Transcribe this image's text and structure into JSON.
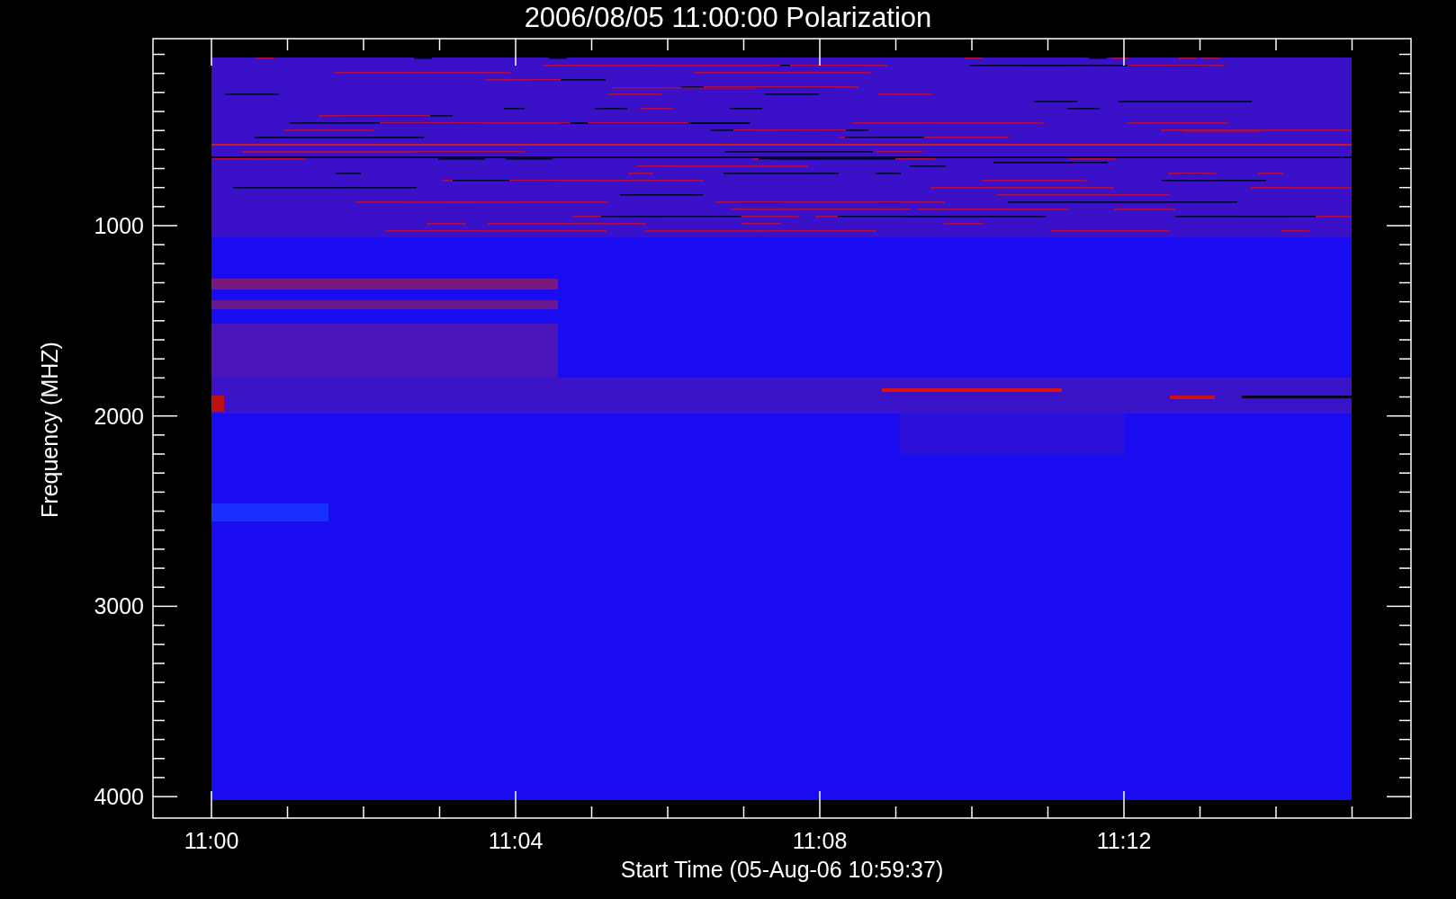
{
  "title": "2006/08/05 11:00:00 Polarization",
  "y_axis": {
    "label": "Frequency (MHZ)",
    "ticks": [
      "1000",
      "2000",
      "3000",
      "4000"
    ]
  },
  "x_axis": {
    "label": "Start Time (05-Aug-06 10:59:37)",
    "ticks": [
      "11:00",
      "11:04",
      "11:08",
      "11:12"
    ]
  }
}
